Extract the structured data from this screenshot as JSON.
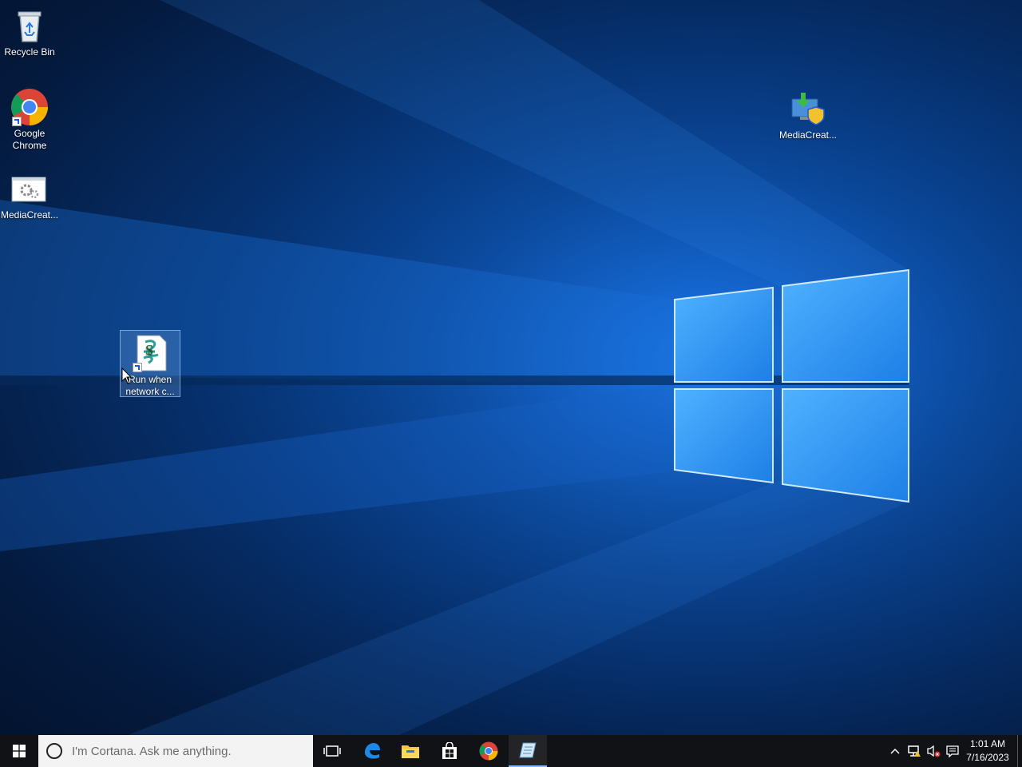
{
  "desktop": {
    "icons": [
      {
        "label": "Recycle Bin"
      },
      {
        "label": "Google Chrome"
      },
      {
        "label": "MediaCreat..."
      },
      {
        "label": "MediaCreat..."
      },
      {
        "label": "Run when network c..."
      }
    ]
  },
  "taskbar": {
    "search_placeholder": "I'm Cortana. Ask me anything.",
    "pinned": [
      "task-view",
      "edge",
      "file-explorer",
      "store",
      "chrome",
      "notepad-like-app"
    ],
    "clock": {
      "time": "1:01 AM",
      "date": "7/16/2023"
    }
  },
  "colors": {
    "taskbar_bg": "#101216",
    "accent": "#7fb8ff"
  }
}
